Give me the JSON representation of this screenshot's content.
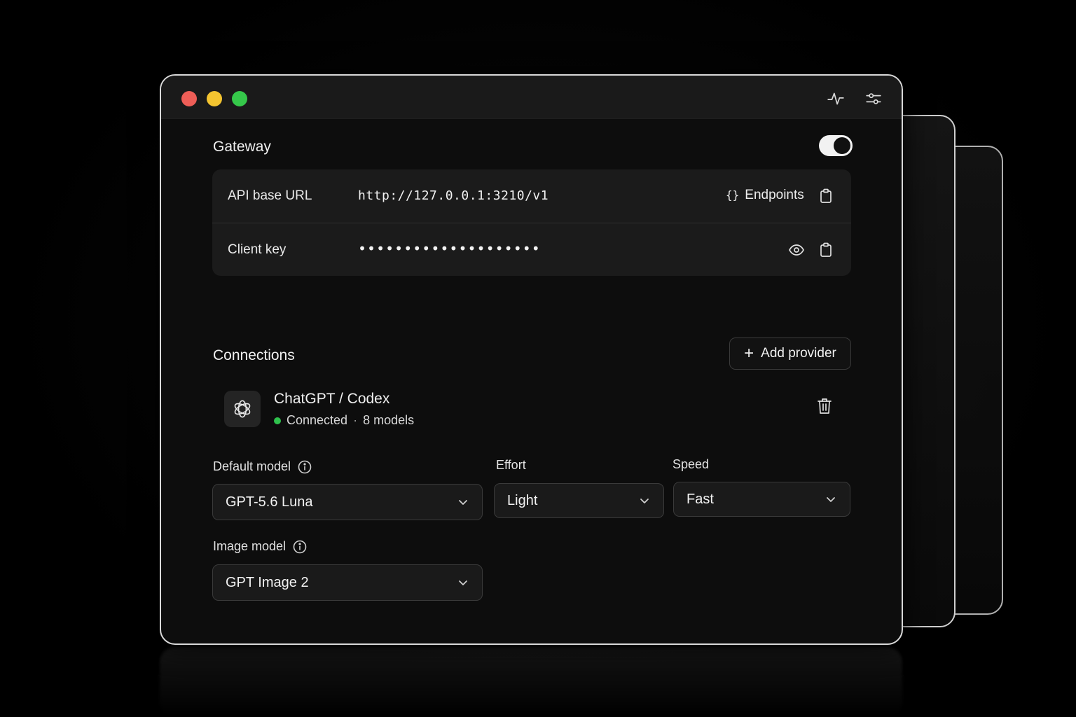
{
  "gateway": {
    "title": "Gateway",
    "enabled": true,
    "api_base_url_label": "API base URL",
    "api_base_url_value": "http://127.0.0.1:3210/v1",
    "endpoints_label": "Endpoints",
    "endpoints_glyph": "{}",
    "client_key_label": "Client key",
    "client_key_value": "••••••••••••••••••••"
  },
  "connections": {
    "title": "Connections",
    "add_provider_label": "Add provider",
    "providers": [
      {
        "name": "ChatGPT / Codex",
        "status": "Connected",
        "separator": "·",
        "models": "8 models",
        "status_color": "#2fc24d"
      }
    ]
  },
  "settings": {
    "default_model_label": "Default model",
    "default_model_value": "GPT-5.6 Luna",
    "effort_label": "Effort",
    "effort_value": "Light",
    "speed_label": "Speed",
    "speed_value": "Fast",
    "image_model_label": "Image model",
    "image_model_value": "GPT Image 2"
  },
  "icons": {
    "titlebar": [
      "activity-icon",
      "sliders-icon"
    ],
    "row": [
      "copy-icon",
      "eye-icon",
      "trash-icon",
      "info-icon",
      "chevron-down-icon",
      "openai-logo-icon"
    ]
  },
  "colors": {
    "traffic_red": "#ee5e57",
    "traffic_yellow": "#f4c430",
    "traffic_green": "#35c84a",
    "window_bg": "#0d0d0d",
    "card_bg": "#1b1b1b"
  }
}
